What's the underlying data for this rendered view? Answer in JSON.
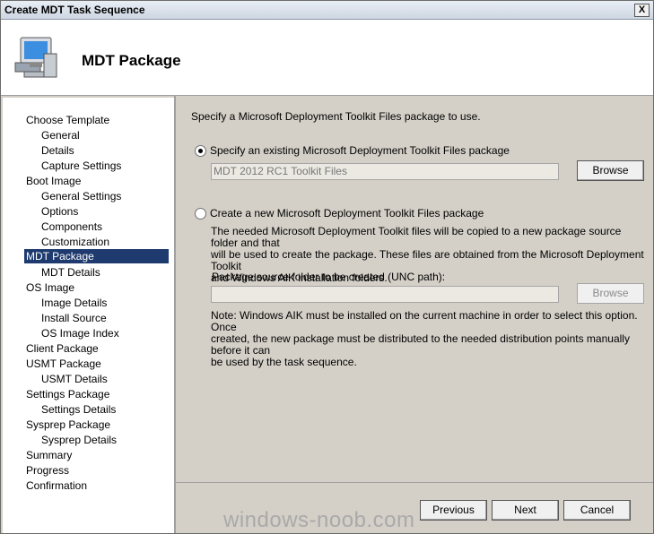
{
  "window": {
    "title": "Create MDT Task Sequence",
    "close_label": "X"
  },
  "header": {
    "title": "MDT Package"
  },
  "sidebar": {
    "items": [
      {
        "label": "Choose Template"
      },
      {
        "label": "General"
      },
      {
        "label": "Details"
      },
      {
        "label": "Capture Settings"
      },
      {
        "label": "Boot Image"
      },
      {
        "label": "General Settings"
      },
      {
        "label": "Options"
      },
      {
        "label": "Components"
      },
      {
        "label": "Customization"
      },
      {
        "label": "MDT Package"
      },
      {
        "label": "MDT Details"
      },
      {
        "label": "OS Image"
      },
      {
        "label": "Image Details"
      },
      {
        "label": "Install Source"
      },
      {
        "label": "OS Image Index"
      },
      {
        "label": "Client Package"
      },
      {
        "label": "USMT Package"
      },
      {
        "label": "USMT Details"
      },
      {
        "label": "Settings Package"
      },
      {
        "label": "Settings Details"
      },
      {
        "label": "Sysprep Package"
      },
      {
        "label": "Sysprep Details"
      },
      {
        "label": "Summary"
      },
      {
        "label": "Progress"
      },
      {
        "label": "Confirmation"
      }
    ],
    "selected": "MDT Package"
  },
  "main": {
    "intro": "Specify a Microsoft Deployment Toolkit Files package to use.",
    "option_existing": {
      "label": "Specify an existing Microsoft Deployment Toolkit Files package",
      "checked": true,
      "value": "MDT 2012 RC1 Toolkit Files",
      "browse": "Browse"
    },
    "option_new": {
      "label": "Create a new Microsoft Deployment Toolkit Files package",
      "checked": false,
      "description_lines": [
        "The needed Microsoft Deployment Toolkit files will be copied to a new package source folder and that",
        "will be used to create the package.  These files are obtained from the Microsoft Deployment Toolkit",
        "and Windows AIK installation folders."
      ],
      "path_label": "Package source folder to be created (UNC path):",
      "path_value": "",
      "browse": "Browse",
      "note_lines": [
        "Note: Windows AIK must be installed on the current machine in order to select this option.  Once",
        "created, the new package must be distributed to the needed distribution points manually before it can",
        "be used by the task sequence."
      ]
    }
  },
  "footer": {
    "previous": "Previous",
    "next": "Next",
    "cancel": "Cancel"
  },
  "watermark": "windows-noob.com",
  "colors": {
    "selection": "#1e3a6e",
    "dialog_bg": "#d4d0c8"
  }
}
